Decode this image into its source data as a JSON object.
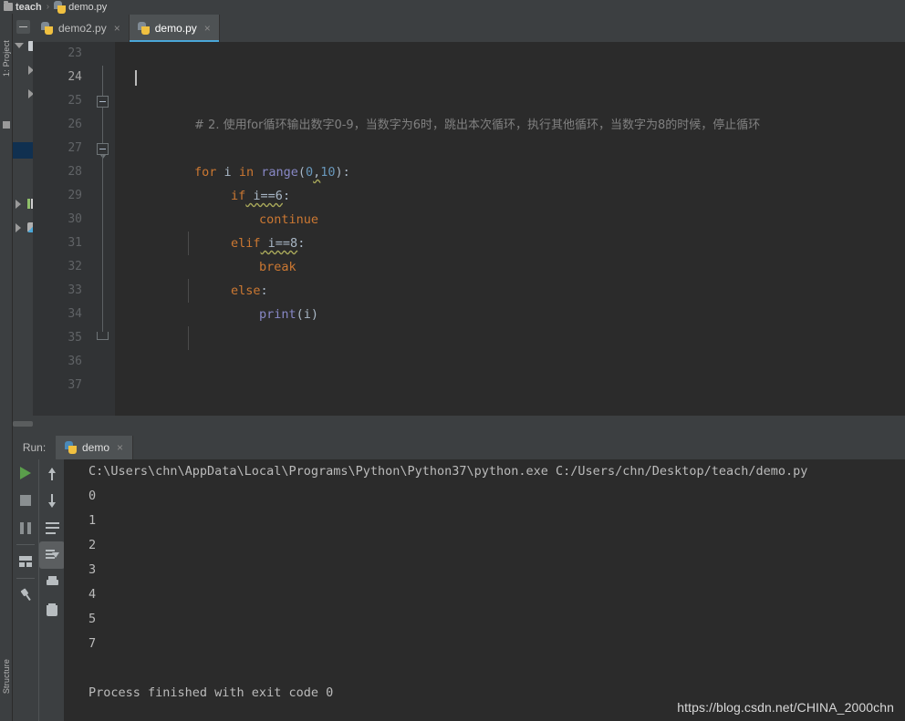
{
  "breadcrumb": {
    "folder": "teach",
    "separator": "›",
    "file": "demo.py"
  },
  "left_stripe": {
    "project_label": "1: Project",
    "structure_label": "Structure"
  },
  "tabs": [
    {
      "label": "demo2.py",
      "close": "×",
      "active": false
    },
    {
      "label": "demo.py",
      "close": "×",
      "active": true
    }
  ],
  "editor": {
    "first_line_number": 23,
    "current_line": 24,
    "line_numbers": [
      23,
      24,
      25,
      26,
      27,
      28,
      29,
      30,
      31,
      32,
      33,
      34,
      35,
      36,
      37
    ],
    "lines": [
      {
        "n": 23,
        "text": ""
      },
      {
        "n": 24,
        "text": ""
      },
      {
        "n": 25,
        "text": "# 2. 使用for循环输出数字0-9，当数字为6时，跳出本次循环，执行其他循环，当数字为8的时候，停止循环"
      },
      {
        "n": 26,
        "text": ""
      },
      {
        "n": 27,
        "text": "for i in range(0,10):"
      },
      {
        "n": 28,
        "text": "    if i==6:"
      },
      {
        "n": 29,
        "text": "        continue"
      },
      {
        "n": 30,
        "text": "    elif i==8:"
      },
      {
        "n": 31,
        "text": "        break"
      },
      {
        "n": 32,
        "text": "    else:"
      },
      {
        "n": 33,
        "text": "        print(i)"
      },
      {
        "n": 34,
        "text": ""
      },
      {
        "n": 35,
        "text": ""
      },
      {
        "n": 36,
        "text": ""
      },
      {
        "n": 37,
        "text": ""
      }
    ],
    "tokens": {
      "comment": "# 2. 使用for循环输出数字0-9，当数字为6时，跳出本次循环，执行其他循环，当数字为8的时候，停止循环",
      "kw_for": "for",
      "var_i": " i ",
      "kw_in": "in",
      "fn_range": " range",
      "paren_open": "(",
      "num_0": "0",
      "comma": ",",
      "num_10": "10",
      "paren_close_colon": "):",
      "kw_if": "if",
      "cond_i6": " i==6",
      "colon": ":",
      "kw_continue": "continue",
      "kw_elif": "elif",
      "cond_i8": " i==8",
      "kw_break": "break",
      "kw_else": "else",
      "fn_print": "print",
      "print_args": "(i)"
    },
    "colors": {
      "background": "#2b2b2b",
      "gutter": "#313335",
      "keyword": "#cc7832",
      "number": "#6897bb",
      "function": "#8888c6",
      "comment": "#808080",
      "text": "#a9b7c6",
      "current_line": "#323232"
    }
  },
  "run_panel": {
    "title": "Run:",
    "tab_label": "demo",
    "tab_close": "×",
    "toolbar_left": [
      {
        "name": "run-button",
        "icon": "play-icon"
      },
      {
        "name": "stop-button",
        "icon": "stop-icon"
      },
      {
        "name": "pause-output-button",
        "icon": "pause-icon"
      },
      {
        "name": "layout-button",
        "icon": "layout-icon"
      },
      {
        "name": "pin-tab-button",
        "icon": "pin-icon"
      }
    ],
    "toolbar_right": [
      {
        "name": "up-stacktrace-button",
        "icon": "arrow-up-icon"
      },
      {
        "name": "down-stacktrace-button",
        "icon": "arrow-down-icon"
      },
      {
        "name": "soft-wrap-button",
        "icon": "wrap-icon"
      },
      {
        "name": "scroll-to-end-button",
        "icon": "scroll-end-icon",
        "selected": true
      },
      {
        "name": "print-button",
        "icon": "print-icon"
      },
      {
        "name": "clear-all-button",
        "icon": "trash-icon"
      }
    ],
    "console": {
      "command": "C:\\Users\\chn\\AppData\\Local\\Programs\\Python\\Python37\\python.exe C:/Users/chn/Desktop/teach/demo.py",
      "output": [
        "0",
        "1",
        "2",
        "3",
        "4",
        "5",
        "7",
        ""
      ],
      "exit_message": "Process finished with exit code 0"
    }
  },
  "watermark": "https://blog.csdn.net/CHINA_2000chn"
}
